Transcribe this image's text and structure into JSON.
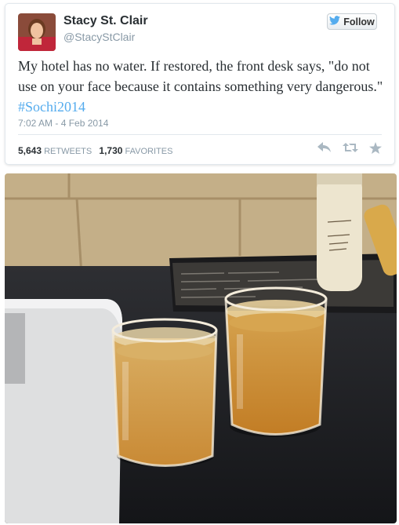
{
  "tweet": {
    "display_name": "Stacy St. Clair",
    "handle": "@StacyStClair",
    "follow_label": "Follow",
    "text_before": "My hotel has no water. If restored, the front desk says, \"do not use on your face because it contains something very dangerous.\" ",
    "hashtag": "#Sochi2014",
    "timestamp": "7:02 AM - 4 Feb 2014",
    "retweets_count": "5,643",
    "retweets_label": "RETWEETS",
    "favorites_count": "1,730",
    "favorites_label": "FAVORITES"
  },
  "icons": {
    "follow": "bird-icon",
    "reply": "reply-icon",
    "retweet": "retweet-icon",
    "favorite": "star-icon"
  },
  "colors": {
    "link": "#55acee",
    "muted": "#8899a6",
    "text": "#292f33"
  }
}
